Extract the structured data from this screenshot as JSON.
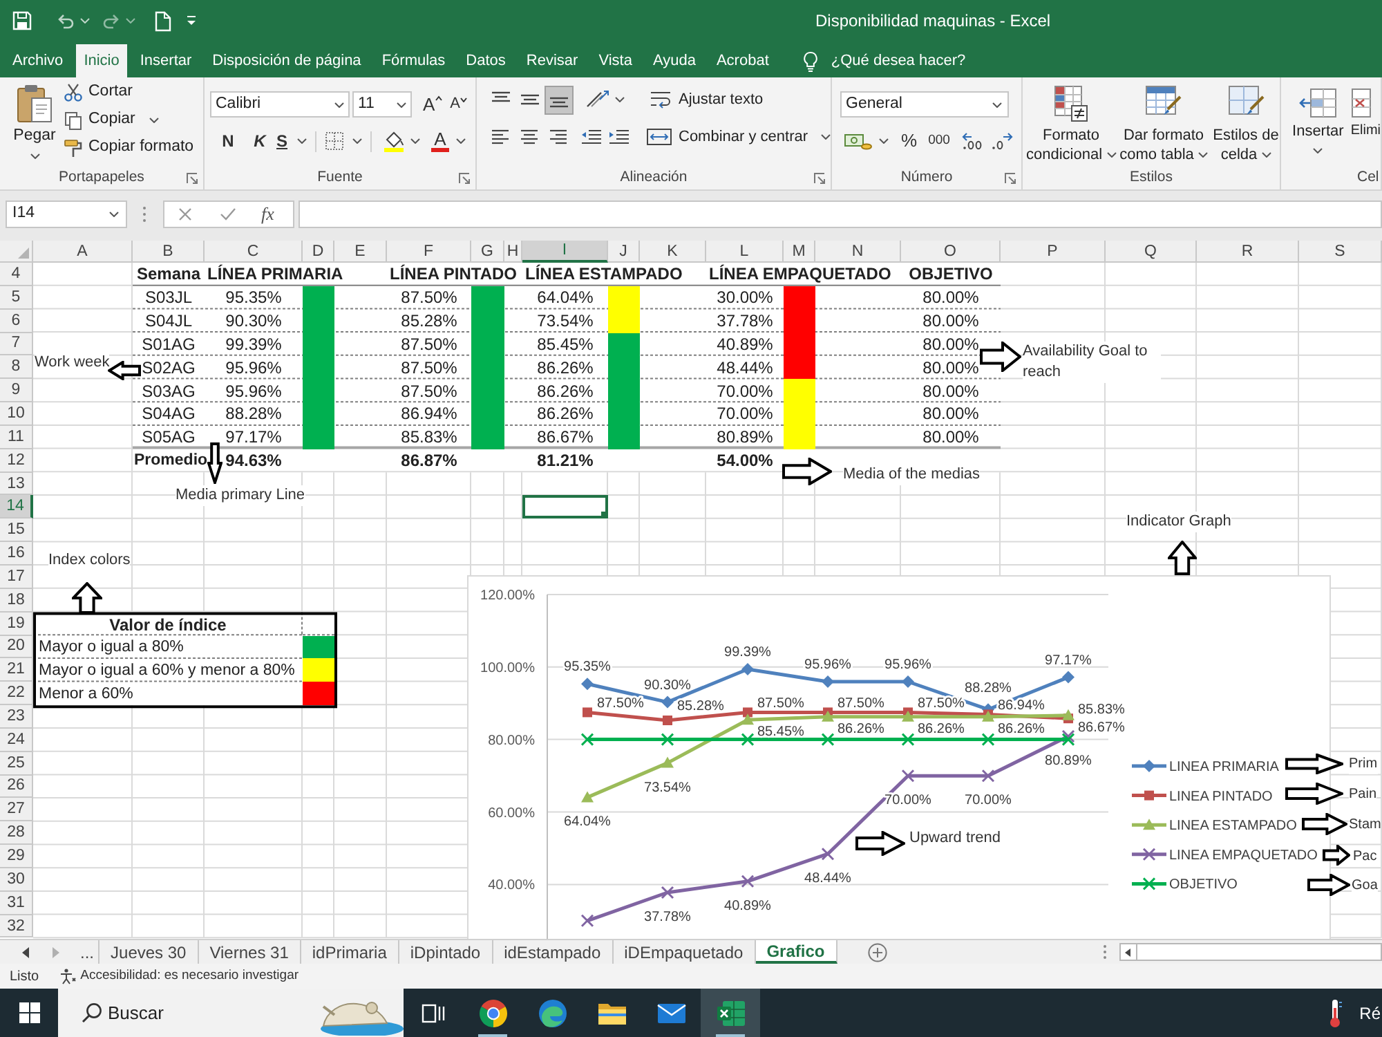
{
  "window": {
    "title": "Disponibilidad maquinas - Excel"
  },
  "ribbon_tabs": [
    {
      "label": "Archivo",
      "selected": false
    },
    {
      "label": "Inicio",
      "selected": true
    },
    {
      "label": "Insertar",
      "selected": false
    },
    {
      "label": "Disposición de página",
      "selected": false
    },
    {
      "label": "Fórmulas",
      "selected": false
    },
    {
      "label": "Datos",
      "selected": false
    },
    {
      "label": "Revisar",
      "selected": false
    },
    {
      "label": "Vista",
      "selected": false
    },
    {
      "label": "Ayuda",
      "selected": false
    },
    {
      "label": "Acrobat",
      "selected": false
    }
  ],
  "tell_me": "¿Qué desea hacer?",
  "ribbon": {
    "clipboard": {
      "paste": "Pegar",
      "cut": "Cortar",
      "copy": "Copiar",
      "format_painter": "Copiar formato",
      "label": "Portapapeles"
    },
    "font": {
      "name": "Calibri",
      "size": "11",
      "grow": "A",
      "shrink": "A",
      "bold": "N",
      "italic": "K",
      "underline": "S",
      "font_color": "A",
      "label": "Fuente"
    },
    "alignment": {
      "vertical_align": [
        {
          "kind": "top",
          "selected": false
        },
        {
          "kind": "middle",
          "selected": false
        },
        {
          "kind": "bottom",
          "selected": true
        }
      ],
      "wrap_text": "Ajustar texto",
      "merge": "Combinar y centrar",
      "label": "Alineación"
    },
    "number": {
      "format": "General",
      "percent": "%",
      "thousands": "000",
      "label": "Número"
    },
    "styles": {
      "buttons": [
        {
          "lines": [
            "Formato",
            "condicional"
          ]
        },
        {
          "lines": [
            "Dar formato",
            "como tabla"
          ]
        },
        {
          "lines": [
            "Estilos de",
            "celda"
          ]
        }
      ],
      "label": "Estilos"
    },
    "cells": {
      "buttons": [
        "Insertar",
        "Elimi"
      ],
      "label": "Cel"
    }
  },
  "formula_bar": {
    "name_box": "I14",
    "fx": "fx"
  },
  "sheet": {
    "columns": [
      {
        "label": "A",
        "selected": false
      },
      {
        "label": "B",
        "selected": false
      },
      {
        "label": "C",
        "selected": false
      },
      {
        "label": "D",
        "selected": false
      },
      {
        "label": "E",
        "selected": false
      },
      {
        "label": "F",
        "selected": false
      },
      {
        "label": "G",
        "selected": false
      },
      {
        "label": "H",
        "selected": false
      },
      {
        "label": "I",
        "selected": true
      },
      {
        "label": "J",
        "selected": false
      },
      {
        "label": "K",
        "selected": false
      },
      {
        "label": "L",
        "selected": false
      },
      {
        "label": "M",
        "selected": false
      },
      {
        "label": "N",
        "selected": false
      },
      {
        "label": "O",
        "selected": false
      },
      {
        "label": "P",
        "selected": false
      },
      {
        "label": "Q",
        "selected": false
      },
      {
        "label": "R",
        "selected": false
      },
      {
        "label": "S",
        "selected": false
      }
    ],
    "rows": [
      {
        "label": "4",
        "selected": false
      },
      {
        "label": "5",
        "selected": false
      },
      {
        "label": "6",
        "selected": false
      },
      {
        "label": "7",
        "selected": false
      },
      {
        "label": "8",
        "selected": false
      },
      {
        "label": "9",
        "selected": false
      },
      {
        "label": "10",
        "selected": false
      },
      {
        "label": "11",
        "selected": false
      },
      {
        "label": "12",
        "selected": false
      },
      {
        "label": "13",
        "selected": false
      },
      {
        "label": "14",
        "selected": true
      },
      {
        "label": "15",
        "selected": false
      },
      {
        "label": "16",
        "selected": false
      },
      {
        "label": "17",
        "selected": false
      },
      {
        "label": "18",
        "selected": false
      },
      {
        "label": "19",
        "selected": false
      },
      {
        "label": "20",
        "selected": false
      },
      {
        "label": "21",
        "selected": false
      },
      {
        "label": "22",
        "selected": false
      },
      {
        "label": "23",
        "selected": false
      },
      {
        "label": "24",
        "selected": false
      },
      {
        "label": "25",
        "selected": false
      },
      {
        "label": "26",
        "selected": false
      },
      {
        "label": "27",
        "selected": false
      },
      {
        "label": "28",
        "selected": false
      },
      {
        "label": "29",
        "selected": false
      },
      {
        "label": "30",
        "selected": false
      },
      {
        "label": "31",
        "selected": false
      },
      {
        "label": "32",
        "selected": false
      }
    ]
  },
  "data_table": {
    "columns": [
      "Semana",
      "LÍNEA PRIMARIA",
      "LÍNEA PINTADO",
      "LÍNEA ESTAMPADO",
      "LÍNEA EMPAQUETADO",
      "OBJETIVO"
    ],
    "rows": [
      {
        "week": "S03JL",
        "lines": [
          {
            "value": "95.35%",
            "color": "#00b050"
          },
          {
            "value": "87.50%",
            "color": "#00b050"
          },
          {
            "value": "64.04%",
            "color": "#ffff00"
          },
          {
            "value": "30.00%",
            "color": "#ff0000"
          }
        ],
        "goal": "80.00%"
      },
      {
        "week": "S04JL",
        "lines": [
          {
            "value": "90.30%",
            "color": "#00b050"
          },
          {
            "value": "85.28%",
            "color": "#00b050"
          },
          {
            "value": "73.54%",
            "color": "#ffff00"
          },
          {
            "value": "37.78%",
            "color": "#ff0000"
          }
        ],
        "goal": "80.00%"
      },
      {
        "week": "S01AG",
        "lines": [
          {
            "value": "99.39%",
            "color": "#00b050"
          },
          {
            "value": "87.50%",
            "color": "#00b050"
          },
          {
            "value": "85.45%",
            "color": "#00b050"
          },
          {
            "value": "40.89%",
            "color": "#ff0000"
          }
        ],
        "goal": "80.00%"
      },
      {
        "week": "S02AG",
        "lines": [
          {
            "value": "95.96%",
            "color": "#00b050"
          },
          {
            "value": "87.50%",
            "color": "#00b050"
          },
          {
            "value": "86.26%",
            "color": "#00b050"
          },
          {
            "value": "48.44%",
            "color": "#ff0000"
          }
        ],
        "goal": "80.00%"
      },
      {
        "week": "S03AG",
        "lines": [
          {
            "value": "95.96%",
            "color": "#00b050"
          },
          {
            "value": "87.50%",
            "color": "#00b050"
          },
          {
            "value": "86.26%",
            "color": "#00b050"
          },
          {
            "value": "70.00%",
            "color": "#ffff00"
          }
        ],
        "goal": "80.00%"
      },
      {
        "week": "S04AG",
        "lines": [
          {
            "value": "88.28%",
            "color": "#00b050"
          },
          {
            "value": "86.94%",
            "color": "#00b050"
          },
          {
            "value": "86.26%",
            "color": "#00b050"
          },
          {
            "value": "70.00%",
            "color": "#ffff00"
          }
        ],
        "goal": "80.00%"
      },
      {
        "week": "S05AG",
        "lines": [
          {
            "value": "97.17%",
            "color": "#00b050"
          },
          {
            "value": "85.83%",
            "color": "#00b050"
          },
          {
            "value": "86.67%",
            "color": "#00b050"
          },
          {
            "value": "80.89%",
            "color": "#ffff00"
          }
        ],
        "goal": "80.00%"
      }
    ],
    "average": {
      "label": "Promedio",
      "values": [
        "94.63%",
        "86.87%",
        "81.21%",
        "54.00%"
      ]
    }
  },
  "index_table": {
    "title": "Valor de índice",
    "rows": [
      {
        "text": "Mayor o igual a 80%",
        "color": "#00b050"
      },
      {
        "text": "Mayor o igual a 60% y menor a 80%",
        "color": "#ffff00"
      },
      {
        "text": "Menor a 60%",
        "color": "#ff0000"
      }
    ]
  },
  "annotations": [
    {
      "text": "Work week",
      "kind": "left"
    },
    {
      "text": "Availability Goal to reach",
      "kind": "right"
    },
    {
      "text": "Media primary Line",
      "kind": "down"
    },
    {
      "text": "Media of the medias",
      "kind": "right"
    },
    {
      "text": "Indicator Graph",
      "kind": "up"
    },
    {
      "text": "Index colors",
      "kind": "up"
    },
    {
      "text": "Upward trend",
      "kind": "right"
    },
    {
      "text": "Prim",
      "kind": "right"
    },
    {
      "text": "Pain",
      "kind": "right"
    },
    {
      "text": "Stam",
      "kind": "right"
    },
    {
      "text": "Pac",
      "kind": "right"
    },
    {
      "text": "Goa",
      "kind": "right"
    }
  ],
  "chart": {
    "chart_data": {
      "type": "line",
      "categories": [
        null,
        null,
        null,
        null,
        null,
        null,
        null
      ],
      "ylim": [
        25,
        120
      ],
      "yticks": [
        {
          "value": 40,
          "label": "40.00%"
        },
        {
          "value": 60,
          "label": "60.00%"
        },
        {
          "value": 80,
          "label": "80.00%"
        },
        {
          "value": 100,
          "label": "100.00%"
        },
        {
          "value": 120,
          "label": "120.00%"
        }
      ],
      "grid": true,
      "legend": "right",
      "series": [
        {
          "name": "LINEA PRIMARIA",
          "color": "#4f81bd",
          "marker": "diamond",
          "values": [
            95.35,
            90.3,
            99.39,
            95.96,
            95.96,
            88.28,
            97.17
          ],
          "value_labels": [
            "95.35%",
            "90.30%",
            "99.39%",
            "95.96%",
            "95.96%",
            "88.28%",
            "97.17%"
          ]
        },
        {
          "name": "LINEA PINTADO",
          "color": "#c0504d",
          "marker": "square",
          "values": [
            87.5,
            85.28,
            87.5,
            87.5,
            87.5,
            86.94,
            85.83
          ],
          "value_labels": [
            "87.50%",
            "85.28%",
            "87.50%",
            "87.50%",
            "87.50%",
            "86.94%",
            "85.83%"
          ]
        },
        {
          "name": "LINEA ESTAMPADO",
          "color": "#9bbb59",
          "marker": "triangle",
          "values": [
            64.04,
            73.54,
            85.45,
            86.26,
            86.26,
            86.26,
            86.67
          ],
          "value_labels": [
            "64.04%",
            "73.54%",
            "85.45%",
            "86.26%",
            "86.26%",
            "86.26%",
            "86.67%"
          ]
        },
        {
          "name": "LINEA EMPAQUETADO",
          "color": "#8064a2",
          "marker": "cross",
          "values": [
            30.0,
            37.78,
            40.89,
            48.44,
            70.0,
            70.0,
            80.89
          ],
          "value_labels": [
            null,
            "37.78%",
            "40.89%",
            "48.44%",
            "70.00%",
            "70.00%",
            "80.89%"
          ]
        },
        {
          "name": "OBJETIVO",
          "color": "#00b050",
          "marker": "cross",
          "values": [
            80,
            80,
            80,
            80,
            80,
            80,
            80
          ]
        }
      ]
    }
  },
  "sheet_tabs": {
    "overflow": "...",
    "tabs": [
      {
        "label": "Jueves 30",
        "selected": false
      },
      {
        "label": "Viernes 31",
        "selected": false
      },
      {
        "label": "idPrimaria",
        "selected": false
      },
      {
        "label": "iDpintado",
        "selected": false
      },
      {
        "label": "idEstampado",
        "selected": false
      },
      {
        "label": "iDEmpaquetado",
        "selected": false
      },
      {
        "label": "Grafico",
        "selected": true
      }
    ]
  },
  "status_bar": {
    "status": "Listo",
    "accessibility": "Accesibilidad: es necesario investigar"
  },
  "taskbar": {
    "search": {
      "placeholder": "Buscar"
    },
    "apps": [
      {
        "kind": "task_view",
        "active": false,
        "running": false
      },
      {
        "kind": "chrome",
        "active": false,
        "running": true
      },
      {
        "kind": "edge",
        "active": false,
        "running": false
      },
      {
        "kind": "explorer",
        "active": false,
        "running": false
      },
      {
        "kind": "mail",
        "active": false,
        "running": false
      },
      {
        "kind": "excel",
        "active": true,
        "running": true
      }
    ],
    "tray_text": "Ré"
  }
}
